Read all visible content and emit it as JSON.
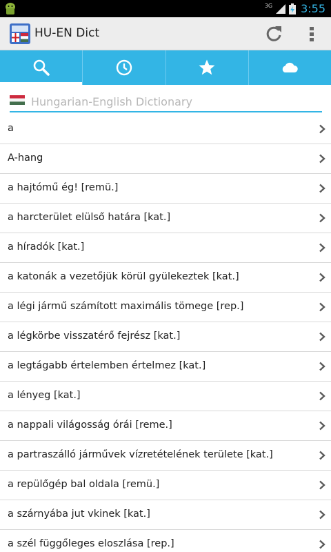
{
  "status_bar": {
    "network": "3G",
    "time": "3:55"
  },
  "app": {
    "title": "HU-EN Dict"
  },
  "tabs": [
    {
      "icon": "search-icon"
    },
    {
      "icon": "history-icon"
    },
    {
      "icon": "favorites-star-icon"
    },
    {
      "icon": "cloud-icon"
    }
  ],
  "search": {
    "placeholder": "Hungarian-English Dictionary",
    "value": ""
  },
  "colors": {
    "accent": "#33b5e5",
    "action_bar": "#ededed",
    "status_bar": "#000000",
    "divider": "#d8d8d8"
  },
  "list": [
    "a",
    "A-hang",
    "a hajtómű ég! [remü.]",
    "a harcterület elülső határa [kat.]",
    "a híradók [kat.]",
    "a katonák a vezetőjük körül gyülekeztek [kat.]",
    "a légi jármű számított maximális tömege [rep.]",
    "a légkörbe visszatérő fejrész [kat.]",
    "a legtágabb értelemben értelmez [kat.]",
    "a lényeg [kat.]",
    "a nappali világosság órái [reme.]",
    "a partraszálló járművek vízretételének területe [kat.]",
    "a repülőgép bal oldala [remü.]",
    "a szárnyába jut vkinek [kat.]",
    "a szél függőleges eloszlása [rep.]"
  ]
}
